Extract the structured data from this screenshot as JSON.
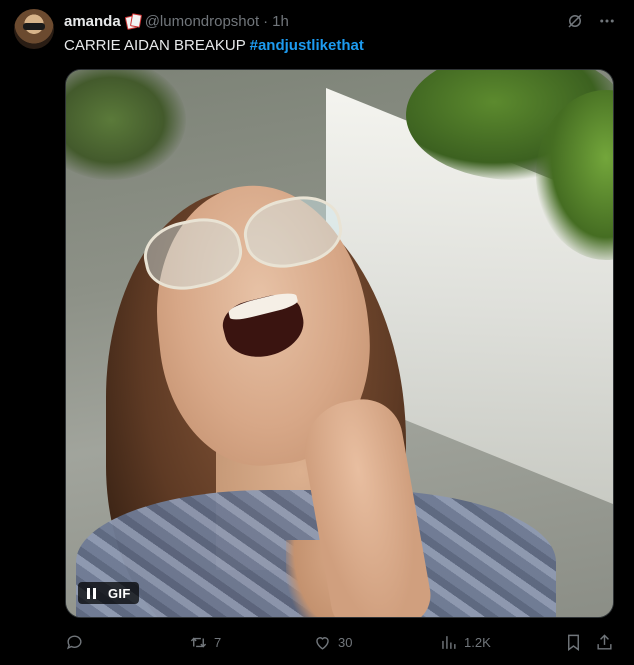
{
  "tweet": {
    "author": {
      "display_name": "amanda",
      "badge_icon": "playing-cards-icon",
      "handle": "@lumondropshot",
      "separator": "·",
      "time": "1h"
    },
    "text_main": "CARRIE AIDAN BREAKUP",
    "hashtag": "#andjustlikethat",
    "media": {
      "type": "gif",
      "badge_label": "GIF",
      "control_icon": "pause-icon"
    },
    "actions": {
      "reply_count": "",
      "retweet_count": "7",
      "like_count": "30",
      "views_count": "1.2K"
    },
    "top_icons": [
      "grok-icon",
      "more-icon"
    ]
  },
  "colors": {
    "background": "#000000",
    "text_primary": "#e7e9ea",
    "text_secondary": "#71767b",
    "link": "#1d9bf0"
  }
}
